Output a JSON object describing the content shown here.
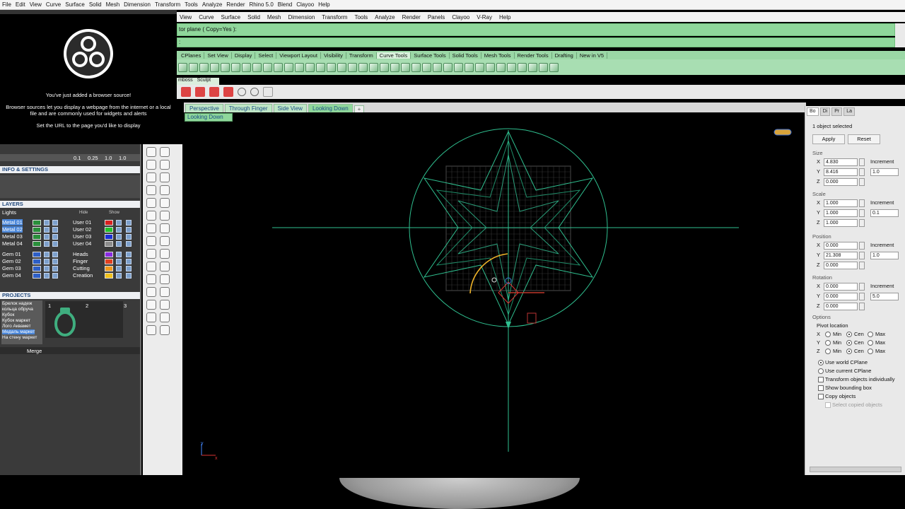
{
  "top_menu": [
    "File",
    "Edit",
    "View",
    "Curve",
    "Surface",
    "Solid",
    "Mesh",
    "Dimension",
    "Transform",
    "Tools",
    "Analyze",
    "Render",
    "Rhino 5.0",
    "Blend",
    "Clayoo",
    "Help"
  ],
  "overlay": {
    "heading": "You've just added a browser source!",
    "body": "Browser sources let you display a webpage from the internet or a local file and are commonly used for widgets and alerts",
    "hint": "Set the URL to the page you'd like to display"
  },
  "rhino_menu": [
    "View",
    "Curve",
    "Surface",
    "Solid",
    "Mesh",
    "Dimension",
    "Transform",
    "Tools",
    "Analyze",
    "Render",
    "Panels",
    "Clayoo",
    "V-Ray",
    "Help"
  ],
  "command": {
    "prompt": "tor plane ( Copy=Yes ):",
    "line2": ":"
  },
  "toolbar_tabs": [
    "CPlanes",
    "Set View",
    "Display",
    "Select",
    "Viewport Layout",
    "Visibility",
    "Transform",
    "Curve Tools",
    "Surface Tools",
    "Solid Tools",
    "Mesh Tools",
    "Render Tools",
    "Drafting",
    "New in V5"
  ],
  "active_toolbar_tab": "Curve Tools",
  "mini_tabs": [
    "mboss",
    "Sculpt"
  ],
  "viewport_tabs": [
    "Perspective",
    "Through Finger",
    "Side View",
    "Looking Down"
  ],
  "active_viewport_tab": "Looking Down",
  "viewport_tab_add": "+",
  "viewport_label": "Looking Down",
  "viewport_axis_y": "y",
  "viewport_axis_x": "x",
  "left_panel": {
    "info_title": "INFO & SETTINGS",
    "layers_title": "LAYERS",
    "lights_label": "Lights",
    "hide_label": "Hide",
    "show_label": "Show",
    "left_layers": [
      "Metal 01",
      "Metal 02",
      "Metal 03",
      "Metal 04",
      "Gem 01",
      "Gem 02",
      "Gem 03",
      "Gem 04"
    ],
    "right_layers": [
      "User 01",
      "User 02",
      "User 03",
      "User 04",
      "Heads",
      "Finger",
      "Cutting",
      "Creation"
    ],
    "projects_title": "PROJECTS",
    "projects": [
      "Брелок надеж",
      "кольца обруча",
      "Кубок",
      "Кубок маркет",
      "Лого Аквамет",
      "Медаль маркет",
      "На стену маркет"
    ],
    "slots": [
      "1",
      "2",
      "3"
    ],
    "merge_label": "Merge",
    "num_fields": [
      "0.1",
      "0.25",
      "1.0",
      "1.0"
    ]
  },
  "right_panel": {
    "tabs": [
      "Bo",
      "Di",
      "Pr",
      "La"
    ],
    "selection": "1 object selected",
    "apply": "Apply",
    "reset": "Reset",
    "size_title": "Size",
    "scale_title": "Scale",
    "position_title": "Position",
    "rotation_title": "Rotation",
    "options_title": "Options",
    "increment_label": "Increment",
    "size": {
      "x": "4.830",
      "y": "8.416",
      "z": "0.000",
      "incr": "1.0"
    },
    "scale": {
      "x": "1.000",
      "y": "1.000",
      "z": "1.000",
      "incr": "0.1"
    },
    "position": {
      "x": "0.000",
      "y": "21.308",
      "z": "0.000",
      "incr": "1.0"
    },
    "rotation": {
      "x": "0.000",
      "y": "0.000",
      "z": "0.000",
      "incr": "5.0"
    },
    "pivot_title": "Pivot location",
    "pivot_min": "Min",
    "pivot_cen": "Cen",
    "pivot_max": "Max",
    "axis_x": "X",
    "axis_y": "Y",
    "axis_z": "Z",
    "use_world": "Use world CPlane",
    "use_current": "Use current CPlane",
    "transform_individually": "Transform objects individually",
    "show_bbox": "Show bounding box",
    "copy_objects": "Copy objects",
    "select_copied": "Select copied objects"
  },
  "colors": {
    "accent_green": "#8fd79b",
    "layer_select": "#4a86d8",
    "geometry_green": "#2fbf8f"
  }
}
